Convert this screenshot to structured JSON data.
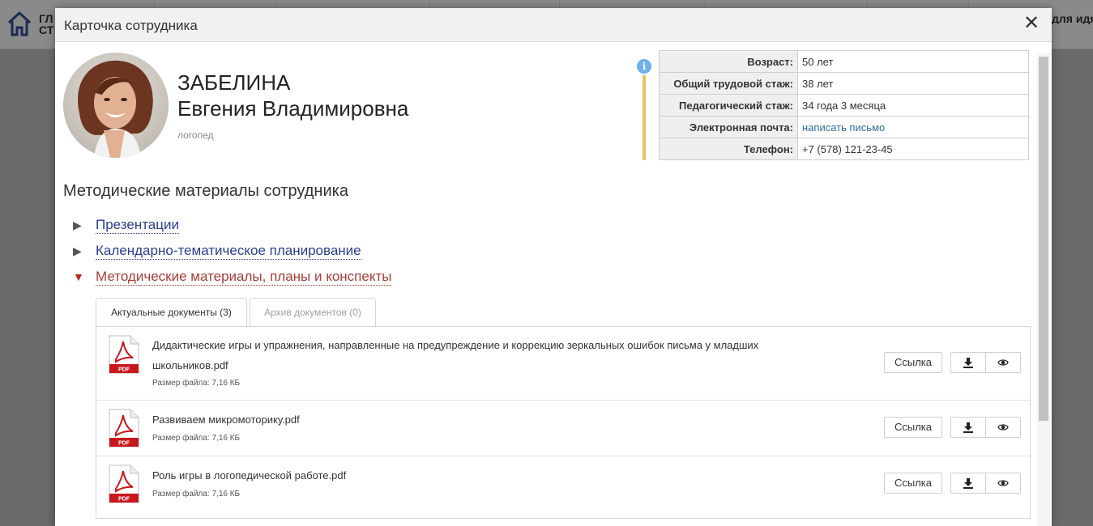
{
  "background": {
    "left_nav_text": "ГЛА СТР",
    "right_nav_text": "для идящи"
  },
  "modal": {
    "title": "Карточка сотрудника",
    "close_glyph": "✕"
  },
  "employee": {
    "last_name": "ЗАБЕЛИНА",
    "first_name": "Евгения Владимировна",
    "position": "логопед"
  },
  "info": {
    "dot_label": "i",
    "rows": [
      {
        "key": "Возраст:",
        "value": "50 лет"
      },
      {
        "key": "Общий трудовой стаж:",
        "value": "38 лет"
      },
      {
        "key": "Педагогический стаж:",
        "value": "34 года 3 месяца"
      },
      {
        "key": "Электронная почта:",
        "value": "написать письмо"
      },
      {
        "key": "Телефон:",
        "value": "+7 (578) 121-23-45"
      }
    ]
  },
  "materials": {
    "title": "Методические материалы сотрудника",
    "folders": [
      {
        "label": "Презентации",
        "expanded": false
      },
      {
        "label": "Календарно-тематическое планирование",
        "expanded": false
      },
      {
        "label": "Методические материалы, планы и конспекты",
        "expanded": true
      }
    ],
    "tabs": [
      {
        "label": "Актуальные документы (3)",
        "active": true
      },
      {
        "label": "Архив документов (0)",
        "active": false
      }
    ],
    "documents": [
      {
        "name": "Дидактические игры и упражнения, направленные на предупреждение и коррекцию зеркальных ошибок письма у младших школьников.pdf",
        "size": "Размер файла: 7,16 КБ"
      },
      {
        "name": "Развиваем микромоторику.pdf",
        "size": "Размер файла: 7,16 КБ"
      },
      {
        "name": "Роль игры в логопедической работе.pdf",
        "size": "Размер файла: 7,16 КБ"
      }
    ],
    "link_button": "Ссылка",
    "pdf_badge": "PDF"
  },
  "colors": {
    "accent_link": "#2a3f8f",
    "active_folder": "#a93d36",
    "pdf_red": "#c8171d"
  }
}
